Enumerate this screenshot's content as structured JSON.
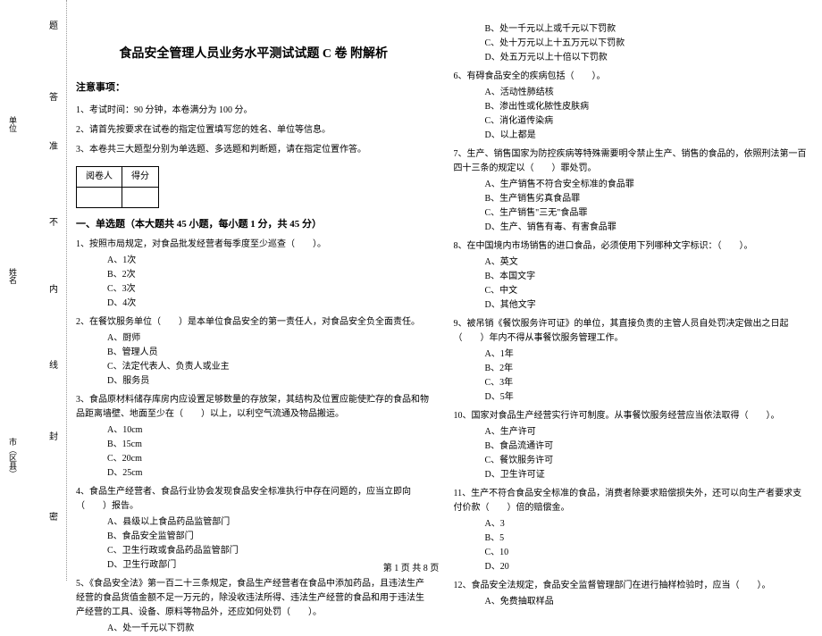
{
  "margin": {
    "chars": [
      "密",
      "封",
      "线",
      "内",
      "不",
      "准",
      "答",
      "题"
    ],
    "labels": [
      "市（区县）",
      "姓名",
      "单位"
    ]
  },
  "title": "食品安全管理人员业务水平测试试题 C 卷 附解析",
  "notice": {
    "heading": "注意事项：",
    "items": [
      "1、考试时间：90 分钟，本卷满分为 100 分。",
      "2、请首先按要求在试卷的指定位置填写您的姓名、单位等信息。",
      "3、本卷共三大题型分别为单选题、多选题和判断题，请在指定位置作答。"
    ]
  },
  "scoreTable": {
    "h1": "阅卷人",
    "h2": "得分"
  },
  "section1": {
    "title": "一、单选题（本大题共 45 小题，每小题 1 分，共 45 分）"
  },
  "q1": {
    "text": "1、按照市局规定，对食品批发经营者每季度至少巡查（　　）。",
    "a": "A、1次",
    "b": "B、2次",
    "c": "C、3次",
    "d": "D、4次"
  },
  "q2": {
    "text": "2、在餐饮服务单位（　　）是本单位食品安全的第一责任人，对食品安全负全面责任。",
    "a": "A、厨师",
    "b": "B、管理人员",
    "c": "C、法定代表人、负责人或业主",
    "d": "D、服务员"
  },
  "q3": {
    "text": "3、食品原材料储存库房内应设置足够数量的存放架，其结构及位置应能使贮存的食品和物品距离墙壁、地面至少在（　　）以上，以利空气流通及物品搬运。",
    "a": "A、10cm",
    "b": "B、15cm",
    "c": "C、20cm",
    "d": "D、25cm"
  },
  "q4": {
    "text": "4、食品生产经营者、食品行业协会发现食品安全标准执行中存在问题的，应当立即向（　　）报告。",
    "a": "A、县级以上食品药品监管部门",
    "b": "B、食品安全监管部门",
    "c": "C、卫生行政或食品药品监管部门",
    "d": "D、卫生行政部门"
  },
  "q5": {
    "text": "5、《食品安全法》第一百二十三条规定，食品生产经营者在食品中添加药品，且违法生产经营的食品货值金额不足一万元的，除没收违法所得、违法生产经营的食品和用于违法生产经营的工具、设备、原料等物品外，还应如何处罚（　　）。",
    "a": "A、处一千元以下罚款"
  },
  "q5b": {
    "b": "B、处一千元以上或千元以下罚款",
    "c": "C、处十万元以上十五万元以下罚款",
    "d": "D、处五万元以上十倍以下罚款"
  },
  "q6": {
    "text": "6、有碍食品安全的疾病包括（　　）。",
    "a": "A、活动性肺结核",
    "b": "B、渗出性或化脓性皮肤病",
    "c": "C、消化道传染病",
    "d": "D、以上都是"
  },
  "q7": {
    "text": "7、生产、销售国家为防控疾病等特殊需要明令禁止生产、销售的食品的，依照刑法第一百四十三条的规定以（　　）罪处罚。",
    "a": "A、生产销售不符合安全标准的食品罪",
    "b": "B、生产销售劣真食品罪",
    "c": "C、生产销售\"三无\"食品罪",
    "d": "D、生产、销售有毒、有害食品罪"
  },
  "q8": {
    "text": "8、在中国境内市场销售的进口食品，必须使用下列哪种文字标识：（　　）。",
    "a": "A、英文",
    "b": "B、本国文字",
    "c": "C、中文",
    "d": "D、其他文字"
  },
  "q9": {
    "text": "9、被吊销《餐饮服务许可证》的单位，其直接负责的主管人员自处罚决定做出之日起（　　）年内不得从事餐饮服务管理工作。",
    "a": "A、1年",
    "b": "B、2年",
    "c": "C、3年",
    "d": "D、5年"
  },
  "q10": {
    "text": "10、国家对食品生产经营实行许可制度。从事餐饮服务经营应当依法取得（　　）。",
    "a": "A、生产许可",
    "b": "B、食品流通许可",
    "c": "C、餐饮服务许可",
    "d": "D、卫生许可证"
  },
  "q11": {
    "text": "11、生产不符合食品安全标准的食品，消费者除要求赔偿损失外，还可以向生产者要求支付价款（　　）倍的赔偿金。",
    "a": "A、3",
    "b": "B、5",
    "c": "C、10",
    "d": "D、20"
  },
  "q12": {
    "text": "12、食品安全法规定，食品安全监督管理部门在进行抽样检验时，应当（　　）。",
    "a": "A、免费抽取样品"
  },
  "footer": "第 1 页 共 8 页"
}
